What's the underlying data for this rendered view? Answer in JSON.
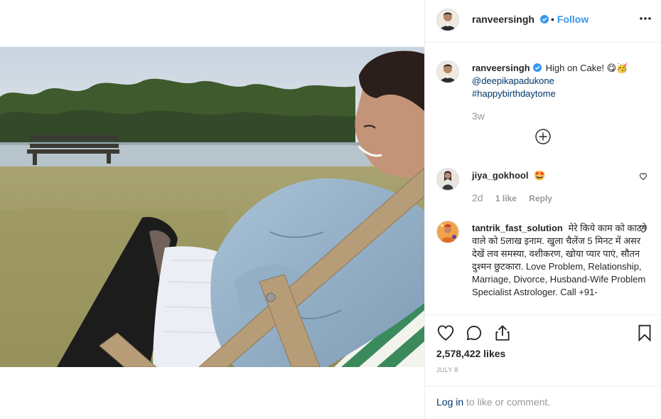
{
  "post": {
    "author": "ranveersingh",
    "follow_separator": "•",
    "follow_label": "Follow",
    "more_icon": "more-horizontal-icon"
  },
  "caption": {
    "username": "ranveersingh",
    "text": "High on Cake! 😋🥳",
    "mention": "@deepikapadukone",
    "hashtag": "#happybirthdaytome",
    "time": "3w"
  },
  "comments": [
    {
      "username": "jiya_gokhool",
      "text": "🤩",
      "time": "2d",
      "likes": "1 like",
      "reply": "Reply"
    },
    {
      "username": "tantrik_fast_solution",
      "text": "मेरे किये काम को काटने वाले को 5लाख इनाम. खुला चैलेंज 5 मिनट में असर देखें लव समस्या, वशीकरण, खोया प्यार पाएं, सौतन दुश्मन छुटकारा. Love Problem, Relationship, Marriage, Divorce, Husband-Wife Problem Specialist Astrologer. Call +91-"
    }
  ],
  "stats": {
    "likes": "2,578,422 likes",
    "date": "JULY 8"
  },
  "login": {
    "link": "Log in",
    "rest": " to like or comment."
  },
  "colors": {
    "accent": "#3897f0",
    "link": "#003569",
    "muted": "#999999",
    "border": "#efefef"
  }
}
